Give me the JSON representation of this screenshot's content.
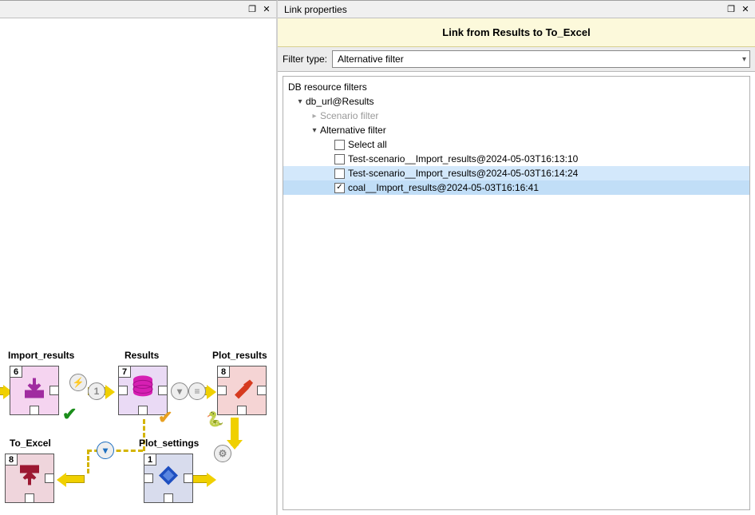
{
  "left": {
    "header_icons": {
      "float": "❐",
      "close": "✕"
    }
  },
  "right": {
    "title": "Link properties",
    "header_icons": {
      "float": "❐",
      "close": "✕"
    },
    "banner": "Link from Results to To_Excel",
    "filter_label": "Filter type:",
    "filter_value": "Alternative filter"
  },
  "tree": {
    "root": "DB resource filters",
    "n0": "db_url@Results",
    "n0_0": "Scenario filter",
    "n0_1": "Alternative filter",
    "items": [
      {
        "label": "Select all",
        "checked": false
      },
      {
        "label": "Test-scenario__Import_results@2024-05-03T16:13:10",
        "checked": false
      },
      {
        "label": "Test-scenario__Import_results@2024-05-03T16:14:24",
        "checked": false
      },
      {
        "label": "coal__Import_results@2024-05-03T16:16:41",
        "checked": true
      }
    ]
  },
  "nodes": {
    "import_results": {
      "title": "Import_results",
      "rank": "6"
    },
    "results": {
      "title": "Results",
      "rank": "7"
    },
    "plot_results": {
      "title": "Plot_results",
      "rank": "8"
    },
    "to_excel": {
      "title": "To_Excel",
      "rank": "8"
    },
    "plot_settings": {
      "title": "Plot_settings",
      "rank": "1"
    }
  }
}
